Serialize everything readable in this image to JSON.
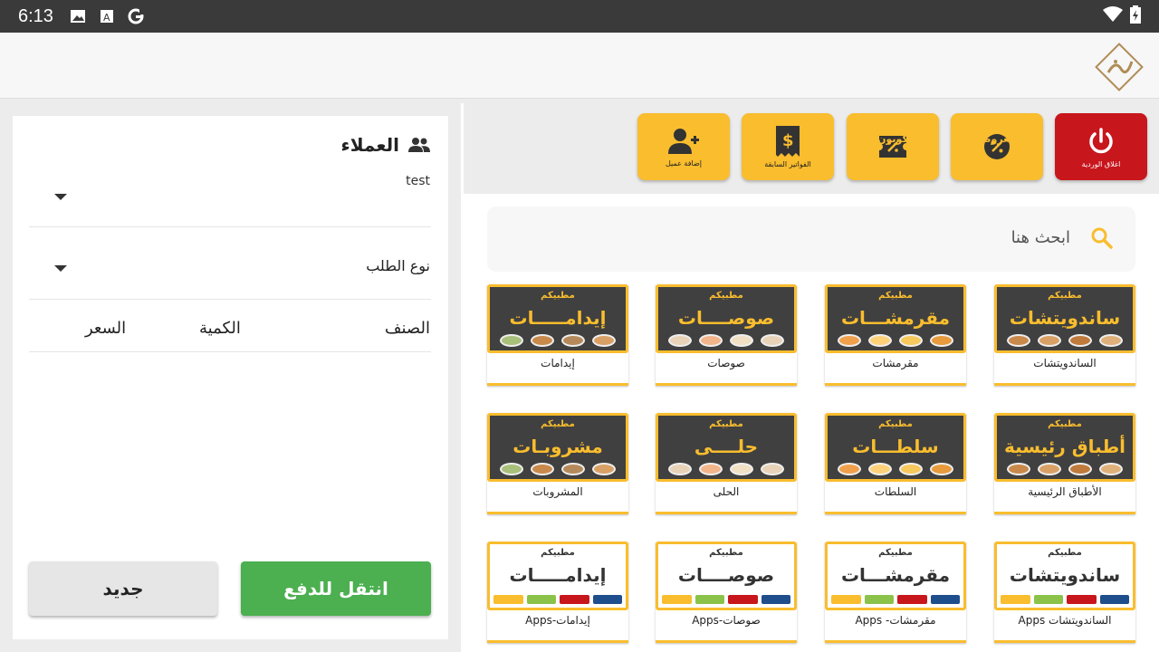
{
  "status": {
    "time": "6:13"
  },
  "actions": [
    {
      "label": "اغلاق الوردية"
    },
    {
      "label": "العروض"
    },
    {
      "label": "كوبون"
    },
    {
      "label": "الفواتير السابقة"
    },
    {
      "label": "إضافة عميل"
    }
  ],
  "search": {
    "placeholder": "ابحث هنا"
  },
  "customers": {
    "title": "العملاء",
    "selected_customer": "test",
    "order_type_label": "نوع الطلب",
    "columns": [
      "الصنف",
      "الكمية",
      "السعر"
    ],
    "btn_new": "جديد",
    "btn_pay": "انتقل للدفع"
  },
  "brand_text": "مطبيكم",
  "categories": [
    {
      "title": "ساندويتشات",
      "name": "الساندويتشات"
    },
    {
      "title": "مقرمشـــات",
      "name": "مقرمشات"
    },
    {
      "title": "صوصــــات",
      "name": "صوصات"
    },
    {
      "title": "إيدامـــــات",
      "name": "إيدامات"
    },
    {
      "title": "أطباق رئيسية",
      "name": "الأطباق الرئيسية"
    },
    {
      "title": "سلطـــات",
      "name": "السلطات"
    },
    {
      "title": "حلــــى",
      "name": "الحلى"
    },
    {
      "title": "مشروبـات",
      "name": "المشروبات"
    },
    {
      "title": "ساندويتشات",
      "name": "Apps الساندويتشات"
    },
    {
      "title": "مقرمشـــات",
      "name": "Apps -مقرمشات"
    },
    {
      "title": "صوصــــات",
      "name": "Apps-صوصات"
    },
    {
      "title": "إيدامـــــات",
      "name": "Apps-إيدامات"
    }
  ]
}
